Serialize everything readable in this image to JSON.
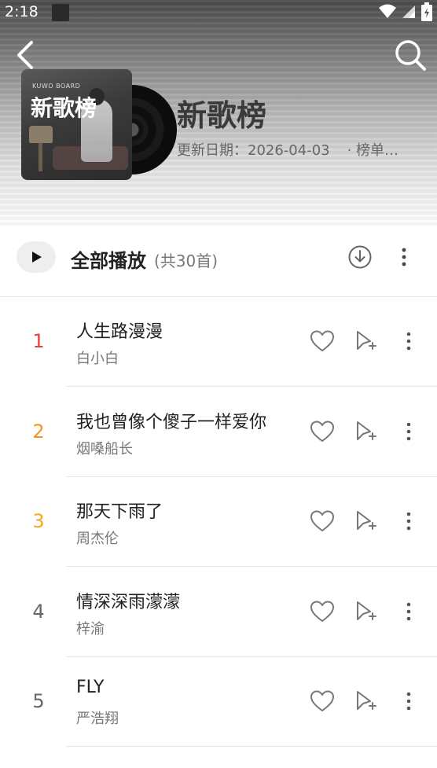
{
  "status_bar": {
    "time": "2:18"
  },
  "header": {
    "cover_label": "KUWO BOARD",
    "cover_title": "新歌榜",
    "title": "新歌榜",
    "update_label": "更新日期：2026-04-03",
    "extra": "· 榜单…"
  },
  "controls": {
    "play_all_label": "全部播放",
    "count_label": "(共30首)"
  },
  "songs": [
    {
      "rank": "1",
      "title": "人生路漫漫",
      "artist": "白小白",
      "rank_color": "#e8413b"
    },
    {
      "rank": "2",
      "title": "我也曾像个傻子一样爱你",
      "artist": "烟嗓船长",
      "rank_color": "#f5921e"
    },
    {
      "rank": "3",
      "title": "那天下雨了",
      "artist": "周杰伦",
      "rank_color": "#f5a81e"
    },
    {
      "rank": "4",
      "title": "情深深雨濛濛",
      "artist": "梓渝",
      "rank_color": "#666666"
    },
    {
      "rank": "5",
      "title": "FLY",
      "artist": "严浩翔",
      "rank_color": "#666666"
    }
  ],
  "icons": {
    "back": "back-icon",
    "search": "search-icon",
    "play": "play-icon",
    "download": "download-icon",
    "more": "more-icon",
    "like": "heart-icon",
    "add": "add-to-playlist-icon"
  }
}
